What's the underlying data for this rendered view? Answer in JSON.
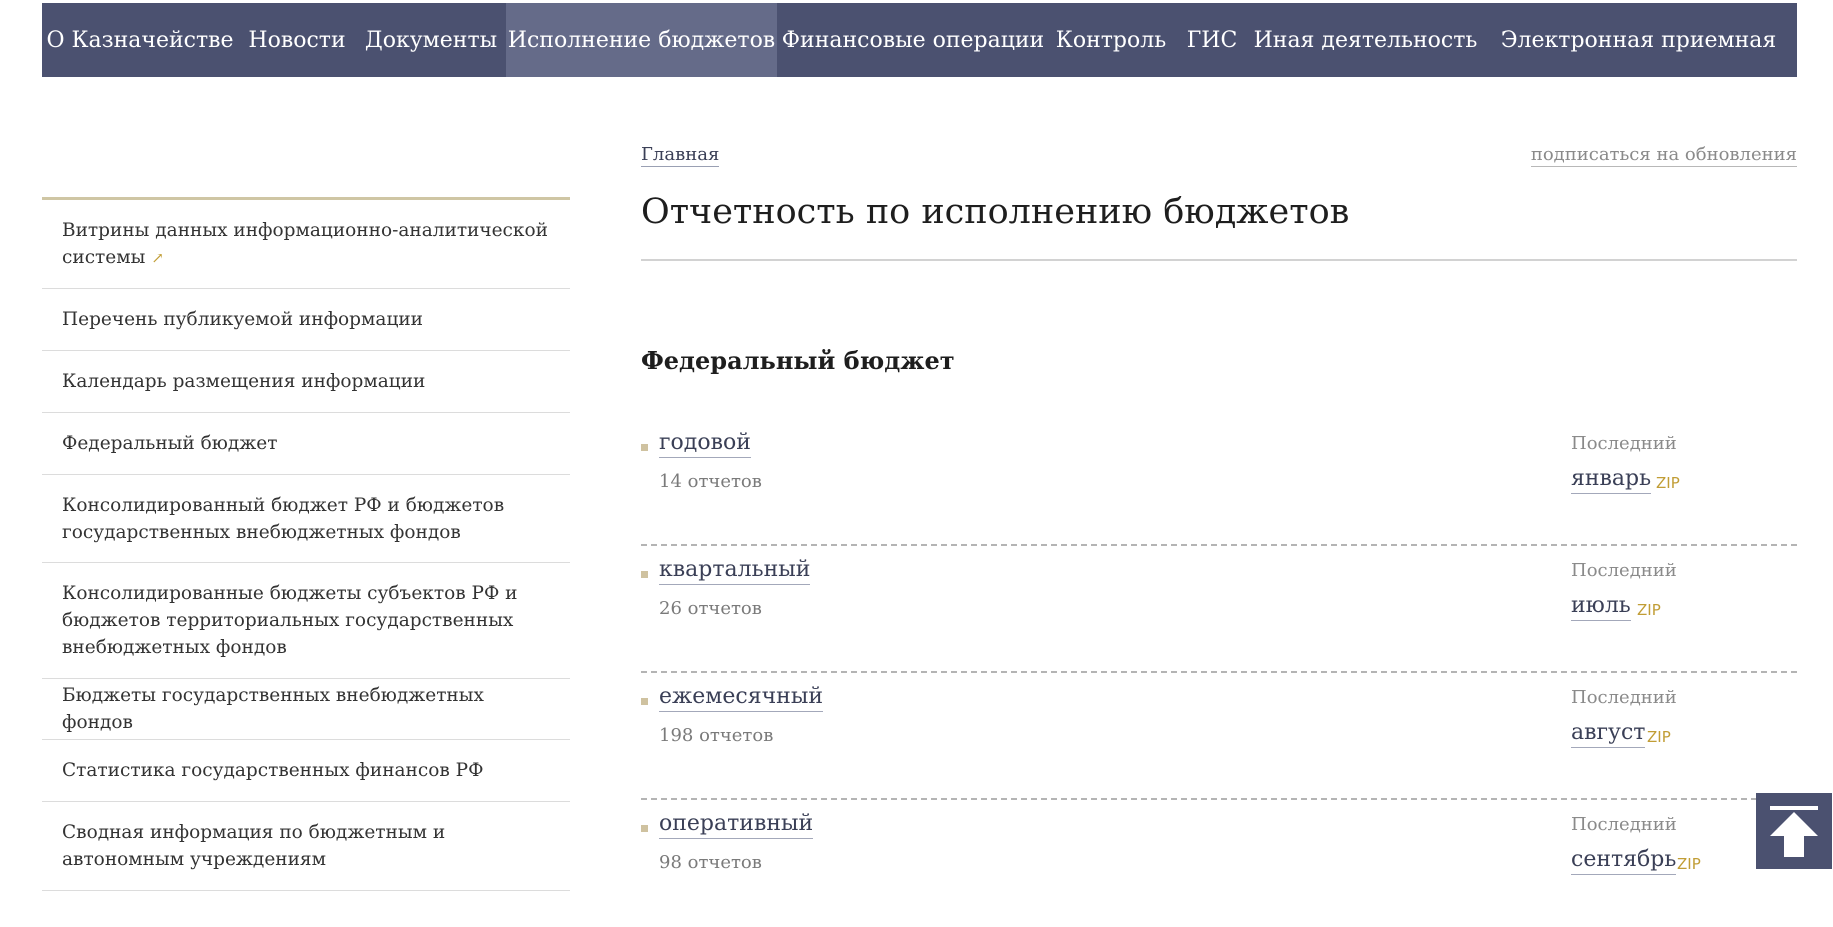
{
  "nav": {
    "items": [
      {
        "label": "О Казначействе",
        "active": false
      },
      {
        "label": "Новости",
        "active": false
      },
      {
        "label": "Документы",
        "active": false
      },
      {
        "label": "Исполнение бюджетов",
        "active": true
      },
      {
        "label": "Финансовые операции",
        "active": false
      },
      {
        "label": "Контроль",
        "active": false
      },
      {
        "label": "ГИС",
        "active": false
      },
      {
        "label": "Иная деятельность",
        "active": false
      },
      {
        "label": "Электронная приемная",
        "active": false
      }
    ]
  },
  "breadcrumb": "Главная",
  "subscribe": "подписаться на обновления",
  "page_title": "Отчетность по исполнению бюджетов",
  "section_title": "Федеральный бюджет",
  "sidebar": {
    "items": [
      {
        "label": "Витрины данных информационно-аналитической системы",
        "external": true
      },
      {
        "label": "Перечень публикуемой информации"
      },
      {
        "label": "Календарь размещения информации"
      },
      {
        "label": "Федеральный бюджет"
      },
      {
        "label": "Консолидированный бюджет РФ и бюджетов государственных внебюджетных фондов"
      },
      {
        "label": "Консолидированные бюджеты субъектов РФ и бюджетов территориальных государственных внебюджетных фондов"
      },
      {
        "label": "Бюджеты государственных внебюджетных фондов"
      },
      {
        "label": "Статистика государственных финансов РФ"
      },
      {
        "label": "Сводная информация по бюджетным и автономным учреждениям"
      }
    ],
    "external_icon": "external-link-arrow-icon"
  },
  "reports": [
    {
      "name": "годовой",
      "count": "14 отчетов",
      "last_label": "Последний",
      "last_month": "январь",
      "zip": "ZIP"
    },
    {
      "name": "квартальный",
      "count": "26 отчетов",
      "last_label": "Последний",
      "last_month": "июль",
      "zip": "ZIP"
    },
    {
      "name": "ежемесячный",
      "count": "198 отчетов",
      "last_label": "Последний",
      "last_month": "август",
      "zip": "ZIP"
    },
    {
      "name": "оперативный",
      "count": "98 отчетов",
      "last_label": "Последний",
      "last_month": "сентябрь",
      "zip": "ZIP"
    }
  ],
  "colors": {
    "nav_bg": "#4b5170",
    "nav_active_bg": "#656b89",
    "accent_gold": "#c19d35",
    "sidebar_top_rule": "#cfc6a4"
  },
  "back_to_top_icon": "arrow-up-to-top-icon"
}
